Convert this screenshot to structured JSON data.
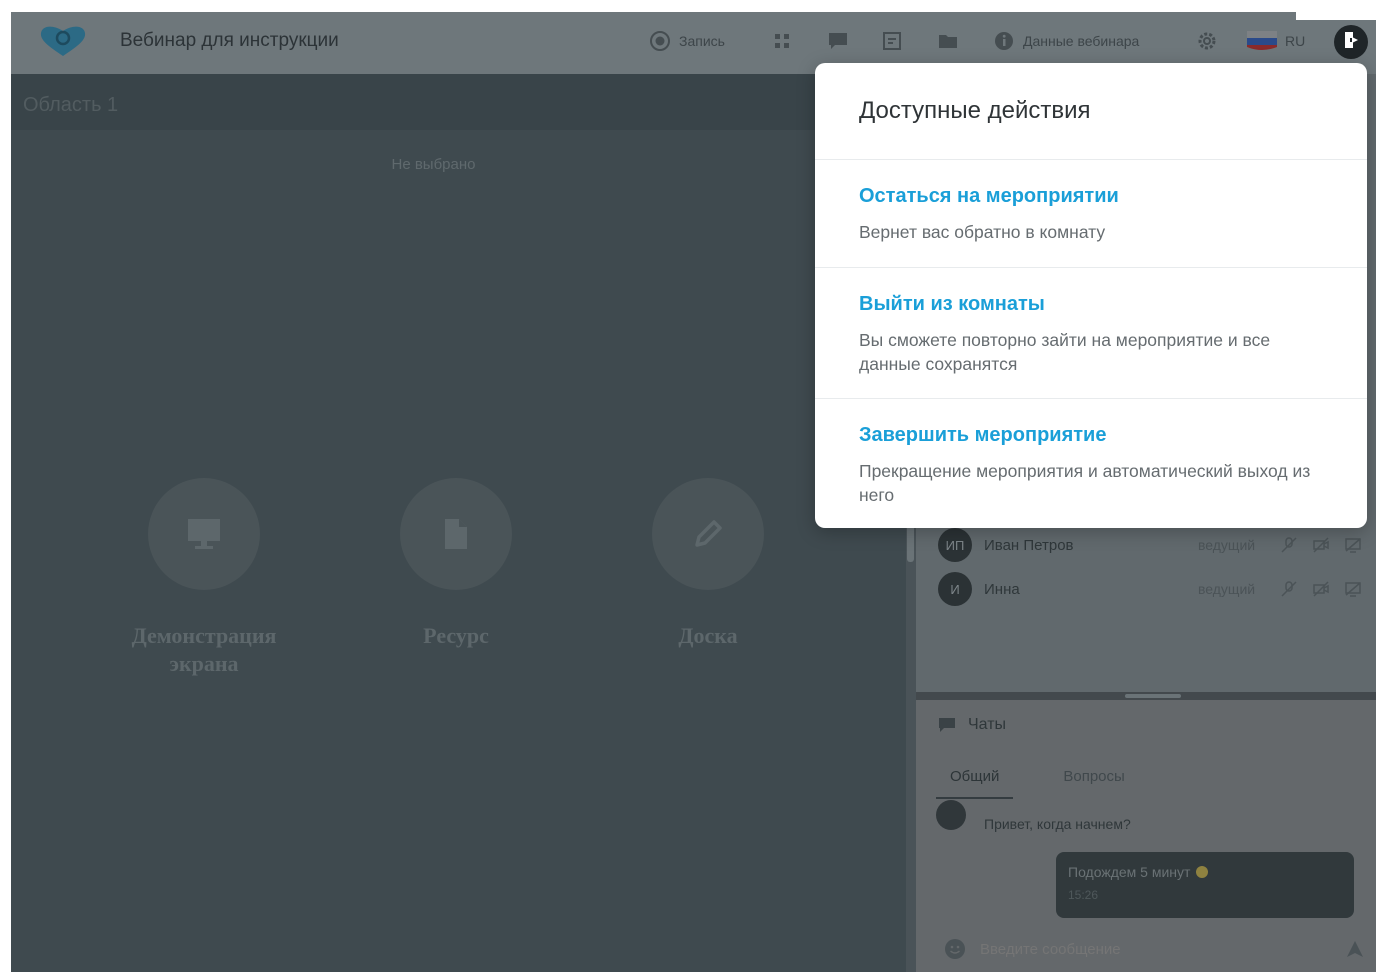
{
  "header": {
    "title": "Вебинар для инструкции",
    "record_label": "Запись",
    "webinar_data_label": "Данные вебинара",
    "language_label": "RU"
  },
  "main": {
    "area_title": "Область 1",
    "not_selected": "Не выбрано",
    "tools": [
      {
        "label": "Демонстрация экрана",
        "icon": "monitor-icon"
      },
      {
        "label": "Ресурс",
        "icon": "file-icon"
      },
      {
        "label": "Доска",
        "icon": "pencil-icon"
      }
    ]
  },
  "participants": [
    {
      "initials": "ИП",
      "name": "Иван Петров",
      "role": "ведущий"
    },
    {
      "initials": "И",
      "name": "Инна",
      "role": "ведущий"
    }
  ],
  "chats": {
    "title": "Чаты",
    "tabs": [
      "Общий",
      "Вопросы"
    ],
    "incoming_message": "Привет, когда начнем?",
    "outgoing_message": "Подождем 5 минут",
    "outgoing_time": "15:26",
    "input_placeholder": "Введите сообщение"
  },
  "modal": {
    "title": "Доступные действия",
    "actions": [
      {
        "title": "Остаться на мероприятии",
        "desc": "Вернет вас обратно в комнату"
      },
      {
        "title": "Выйти из комнаты",
        "desc": "Вы сможете повторно зайти на мероприятие и все данные сохранятся"
      },
      {
        "title": "Завершить мероприятие",
        "desc": "Прекращение мероприятия и автоматический выход из него"
      }
    ]
  },
  "colors": {
    "accent": "#1a9fd8",
    "overlay_bg": "#4a5358"
  }
}
